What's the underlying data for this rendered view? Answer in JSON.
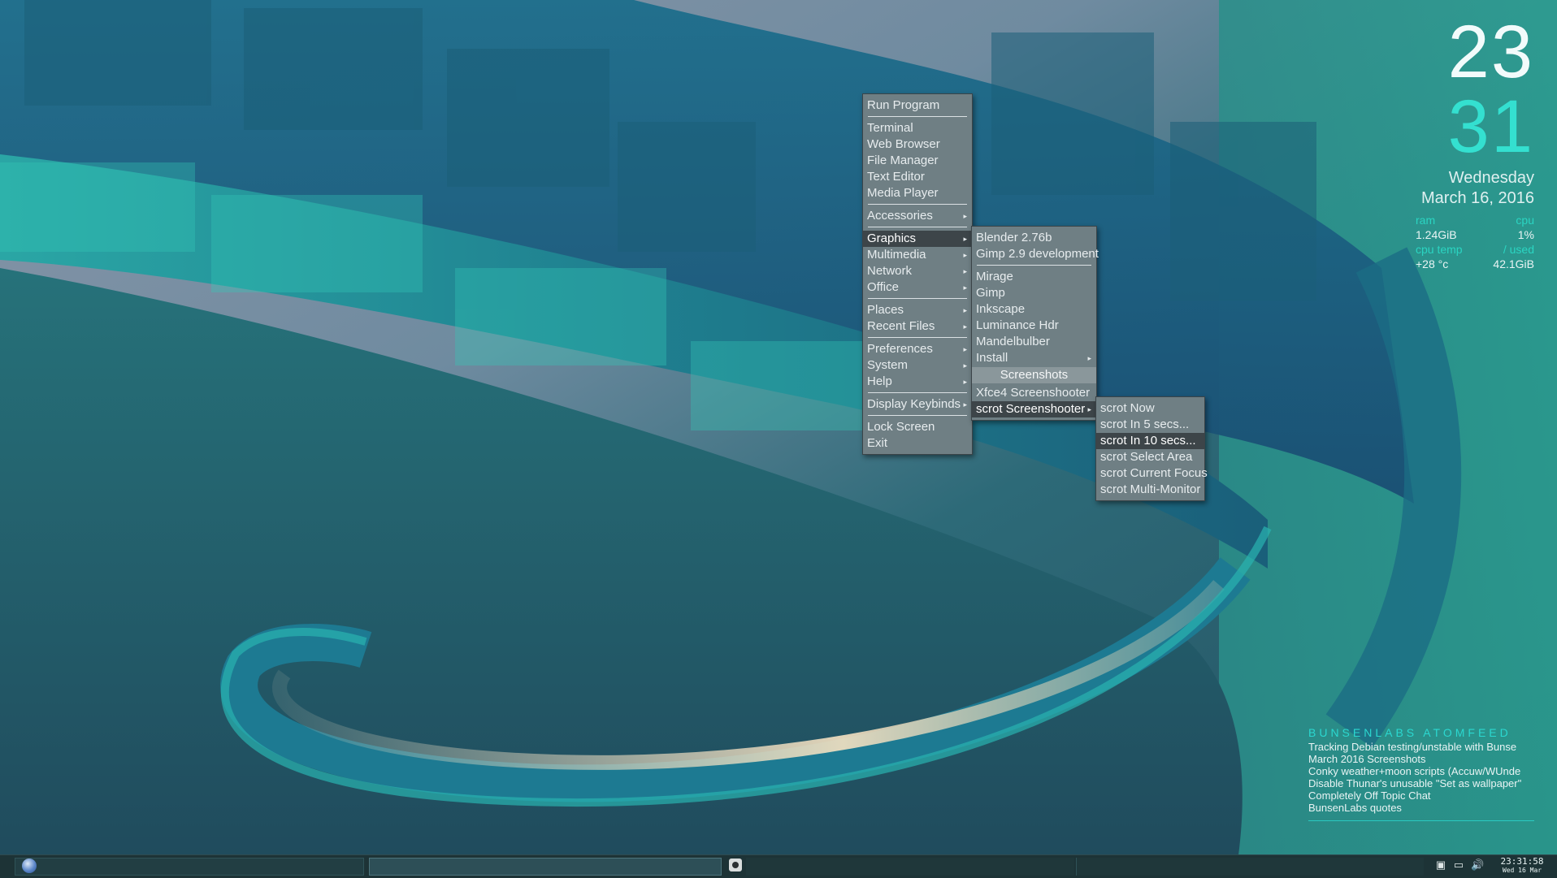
{
  "desktop": {
    "colors": {
      "accent": "#2bd8d0",
      "menu_bg": "#6f7f84",
      "menu_selected": "#3d4549",
      "panel_bg": "#1d3336"
    }
  },
  "root_menu": {
    "items": [
      {
        "label": "Run Program",
        "submenu": false
      },
      {
        "sep": true
      },
      {
        "label": "Terminal",
        "submenu": false
      },
      {
        "label": "Web Browser",
        "submenu": false
      },
      {
        "label": "File Manager",
        "submenu": false
      },
      {
        "label": "Text Editor",
        "submenu": false
      },
      {
        "label": "Media Player",
        "submenu": false
      },
      {
        "sep": true
      },
      {
        "label": "Accessories",
        "submenu": true
      },
      {
        "sep": true
      },
      {
        "label": "Graphics",
        "submenu": true,
        "selected": true
      },
      {
        "label": "Multimedia",
        "submenu": true
      },
      {
        "label": "Network",
        "submenu": true
      },
      {
        "label": "Office",
        "submenu": true
      },
      {
        "sep": true
      },
      {
        "label": "Places",
        "submenu": true
      },
      {
        "label": "Recent Files",
        "submenu": true
      },
      {
        "sep": true
      },
      {
        "label": "Preferences",
        "submenu": true
      },
      {
        "label": "System",
        "submenu": true
      },
      {
        "label": "Help",
        "submenu": true
      },
      {
        "sep": true
      },
      {
        "label": "Display Keybinds",
        "submenu": true
      },
      {
        "sep": true
      },
      {
        "label": "Lock Screen",
        "submenu": false
      },
      {
        "label": "Exit",
        "submenu": false
      }
    ]
  },
  "graphics_menu": {
    "items": [
      {
        "label": "Blender 2.76b"
      },
      {
        "label": "Gimp 2.9 development"
      },
      {
        "sep": true
      },
      {
        "label": "Mirage"
      },
      {
        "label": "Gimp"
      },
      {
        "label": "Inkscape"
      },
      {
        "label": "Luminance Hdr"
      },
      {
        "label": "Mandelbulber"
      },
      {
        "label": "Install",
        "submenu": true
      },
      {
        "header": "Screenshots"
      },
      {
        "label": "Xfce4 Screenshooter"
      },
      {
        "label": "scrot Screenshooter",
        "submenu": true,
        "selected": true
      }
    ]
  },
  "scrot_menu": {
    "items": [
      {
        "label": "scrot Now"
      },
      {
        "label": "scrot In 5 secs..."
      },
      {
        "label": "scrot In 10 secs...",
        "selected": true
      },
      {
        "label": "scrot Select Area"
      },
      {
        "label": "scrot Current Focus"
      },
      {
        "label": "scrot Multi-Monitor"
      }
    ]
  },
  "conky": {
    "hour": "23",
    "minute": "31",
    "weekday": "Wednesday",
    "date": "March 16, 2016",
    "stats": {
      "ram_label": "ram",
      "cpu_label": "cpu",
      "ram_value": "1.24GiB",
      "cpu_value": "1%",
      "temp_label": "cpu temp",
      "used_label": "/ used",
      "temp_value": "+28 °c",
      "used_value": "42.1GiB"
    }
  },
  "feed": {
    "title": "BUNSENLABS ATOMFEED",
    "lines": [
      "Tracking Debian testing/unstable with Bunse",
      "March 2016 Screenshots",
      "Conky weather+moon scripts (Accuw/WUnde",
      "Disable Thunar's unusable \"Set as wallpaper\"",
      "Completely Off Topic Chat",
      "BunsenLabs quotes"
    ]
  },
  "panel": {
    "time": "23:31:58",
    "date": "Wed 16 Mar",
    "tray_icons": [
      "clipboard-icon",
      "display-icon",
      "volume-icon"
    ]
  }
}
